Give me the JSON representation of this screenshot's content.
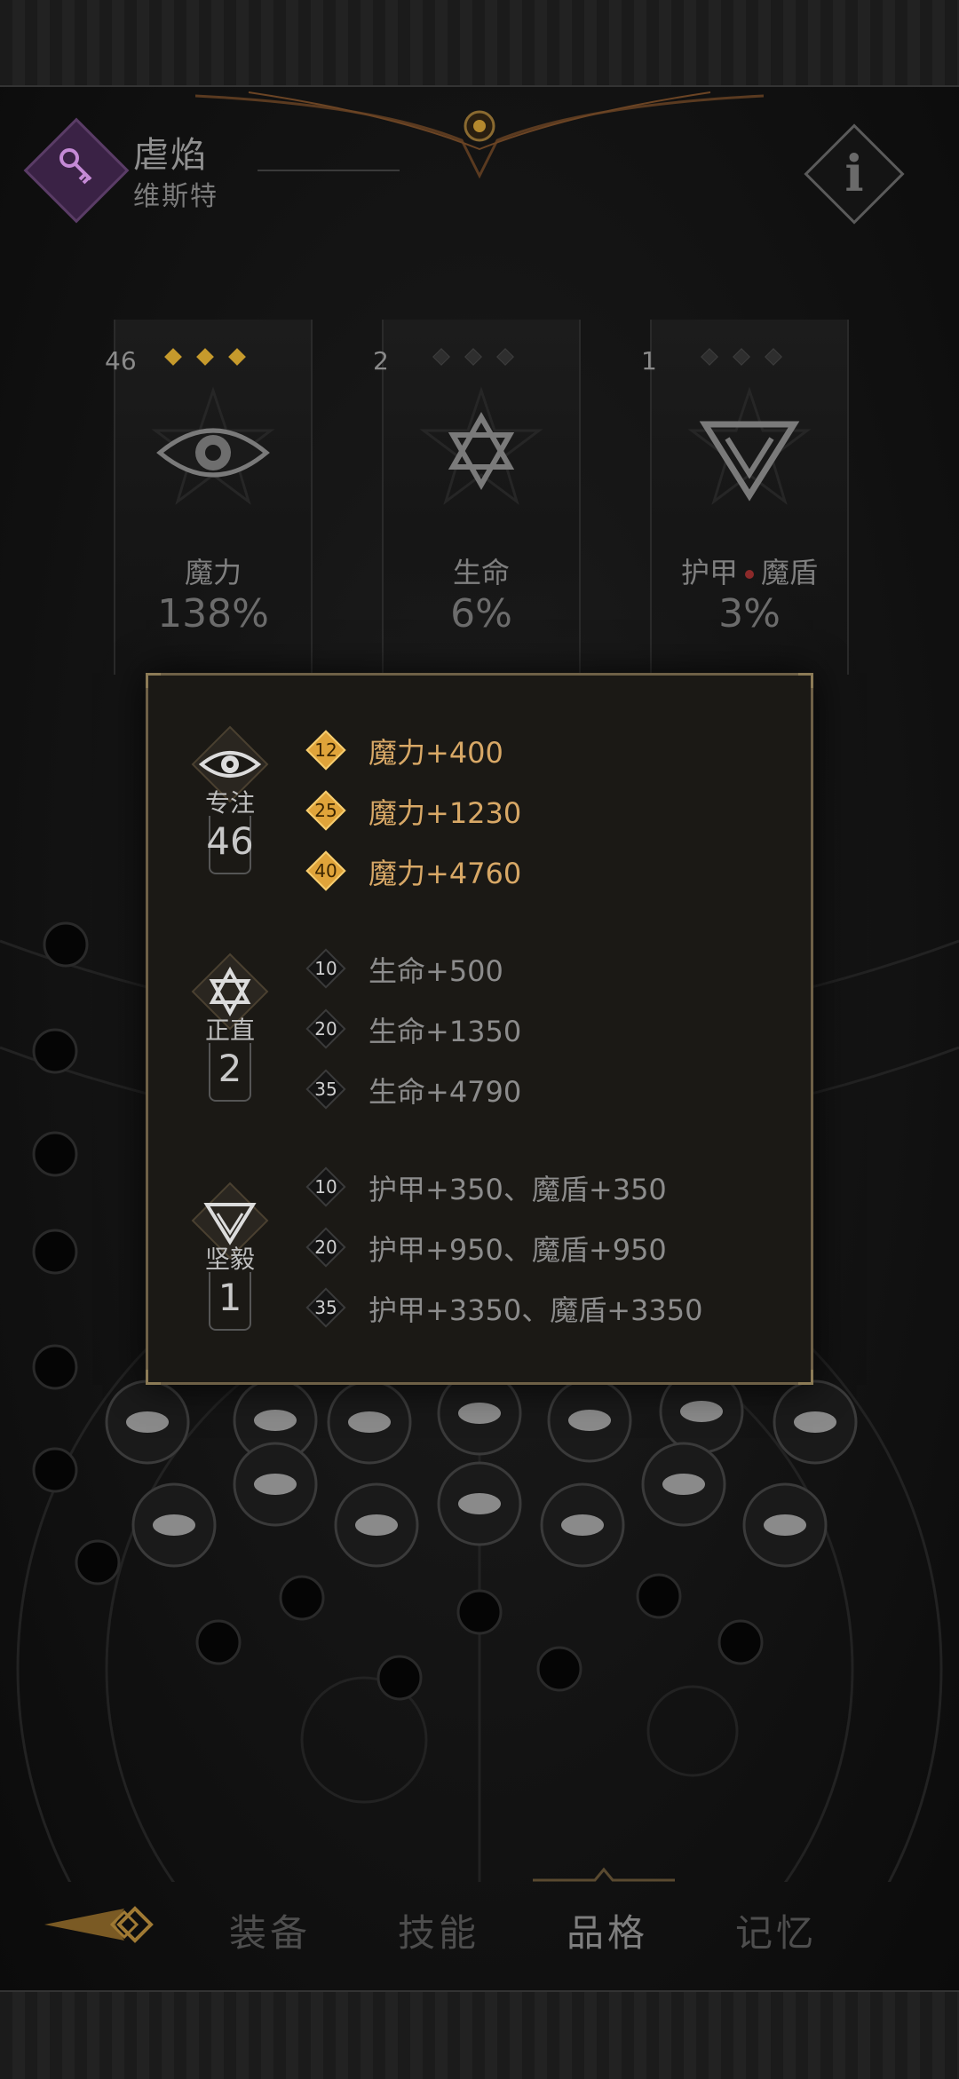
{
  "character": {
    "name": "虐焰",
    "class": "维斯特"
  },
  "attributes": [
    {
      "count": "46",
      "pips_active": 3,
      "label": "魔力",
      "value": "138%",
      "emblem": "eye-emblem"
    },
    {
      "count": "2",
      "pips_active": 0,
      "label": "生命",
      "value": "6%",
      "emblem": "hexagram-emblem"
    },
    {
      "count": "1",
      "pips_active": 0,
      "label_a": "护甲",
      "label_b": "魔盾",
      "value": "3%",
      "emblem": "triangle-emblem"
    }
  ],
  "popup": {
    "groups": [
      {
        "name": "专注",
        "count": "46",
        "emblem": "eye-icon",
        "bonuses": [
          {
            "level": "12",
            "text": "魔力+400",
            "active": true
          },
          {
            "level": "25",
            "text": "魔力+1230",
            "active": true
          },
          {
            "level": "40",
            "text": "魔力+4760",
            "active": true
          }
        ]
      },
      {
        "name": "正直",
        "count": "2",
        "emblem": "hexagram-icon",
        "bonuses": [
          {
            "level": "10",
            "text": "生命+500",
            "active": false
          },
          {
            "level": "20",
            "text": "生命+1350",
            "active": false
          },
          {
            "level": "35",
            "text": "生命+4790",
            "active": false
          }
        ]
      },
      {
        "name": "坚毅",
        "count": "1",
        "emblem": "triangle-icon",
        "bonuses": [
          {
            "level": "10",
            "text": "护甲+350、魔盾+350",
            "active": false
          },
          {
            "level": "20",
            "text": "护甲+950、魔盾+950",
            "active": false
          },
          {
            "level": "35",
            "text": "护甲+3350、魔盾+3350",
            "active": false
          }
        ]
      }
    ]
  },
  "nav": {
    "tabs": [
      "装备",
      "技能",
      "品格",
      "记忆"
    ],
    "active_tab": "品格"
  },
  "colors": {
    "gold": "#e0a43a",
    "gold_text": "#d8a866",
    "popup_border": "#6e6046",
    "char_icon": "#3a2245"
  }
}
